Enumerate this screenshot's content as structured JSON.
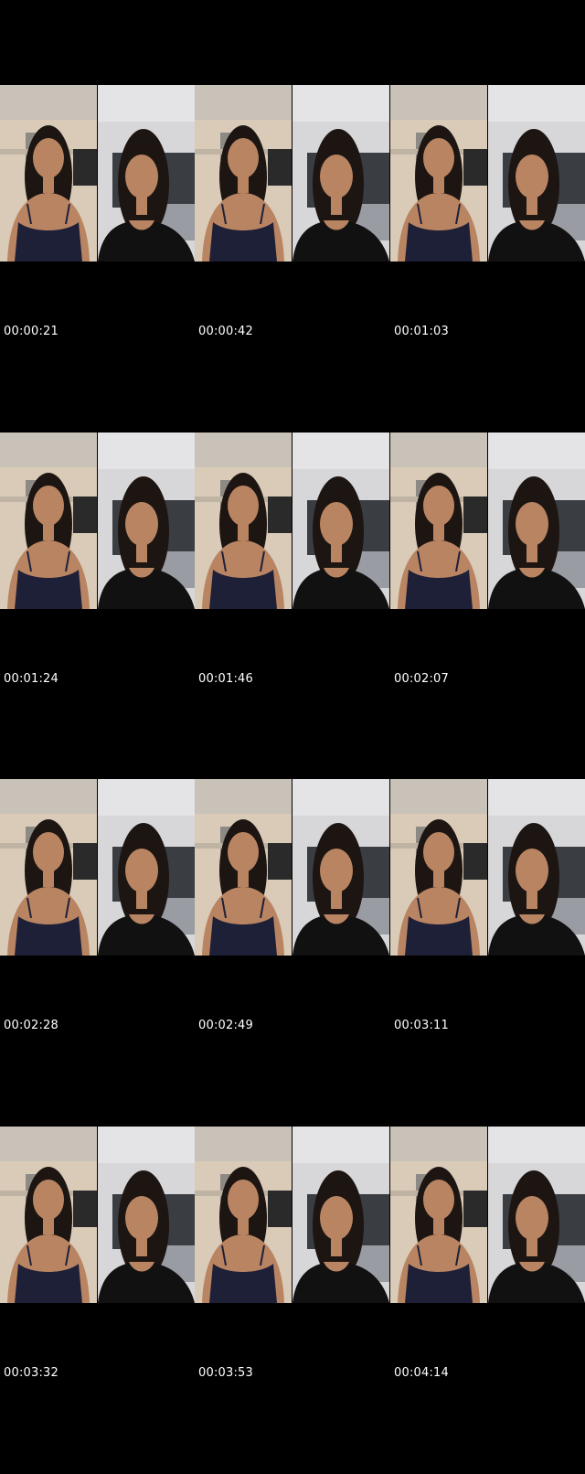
{
  "contact_sheet": {
    "rows": [
      {
        "cells": [
          {
            "timestamp": "00:00:21",
            "left_scene": "kitchen",
            "right_scene": "bedroom"
          },
          {
            "timestamp": "00:00:42",
            "left_scene": "kitchen",
            "right_scene": "bedroom"
          },
          {
            "timestamp": "00:01:03",
            "left_scene": "kitchen",
            "right_scene": "bedroom"
          }
        ]
      },
      {
        "cells": [
          {
            "timestamp": "00:01:24",
            "left_scene": "kitchen",
            "right_scene": "bedroom"
          },
          {
            "timestamp": "00:01:46",
            "left_scene": "kitchen",
            "right_scene": "bedroom"
          },
          {
            "timestamp": "00:02:07",
            "left_scene": "kitchen",
            "right_scene": "bedroom"
          }
        ]
      },
      {
        "cells": [
          {
            "timestamp": "00:02:28",
            "left_scene": "kitchen",
            "right_scene": "bedroom"
          },
          {
            "timestamp": "00:02:49",
            "left_scene": "kitchen",
            "right_scene": "bedroom"
          },
          {
            "timestamp": "00:03:11",
            "left_scene": "kitchen",
            "right_scene": "bedroom"
          }
        ]
      },
      {
        "cells": [
          {
            "timestamp": "00:03:32",
            "left_scene": "kitchen",
            "right_scene": "bedroom"
          },
          {
            "timestamp": "00:03:53",
            "left_scene": "kitchen",
            "right_scene": "bedroom"
          },
          {
            "timestamp": "00:04:14",
            "left_scene": "kitchen",
            "right_scene": "bedroom"
          }
        ]
      }
    ],
    "colors": {
      "background": "#000000",
      "kitchen_wall": "#d9cbb7",
      "kitchen_ceiling": "#c9c2b8",
      "bedroom_wall": "#d7d7d9",
      "tv": "#3a3d42",
      "skin": "#b98462",
      "hair": "#1c1512",
      "top": "#1e2038",
      "top_black": "#111111"
    }
  }
}
